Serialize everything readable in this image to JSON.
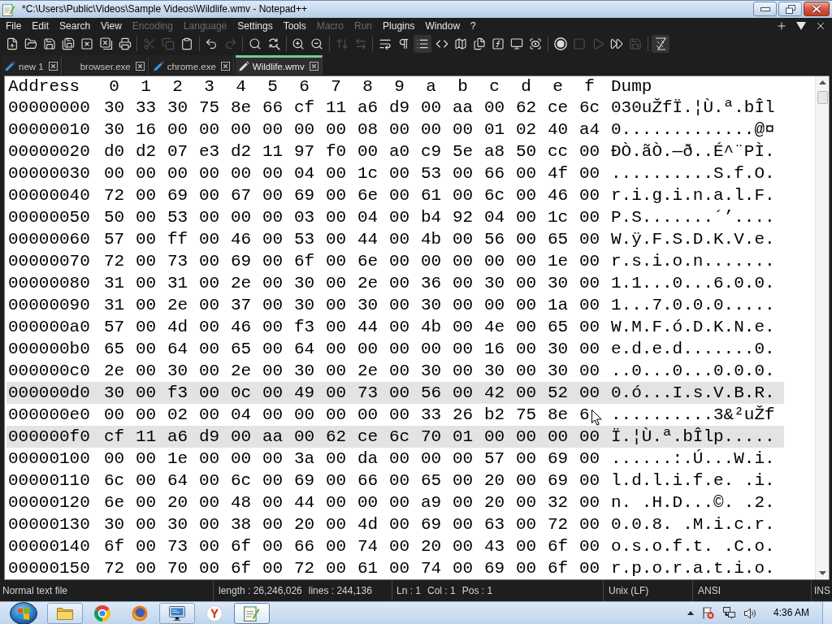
{
  "window": {
    "title": "*C:\\Users\\Public\\Videos\\Sample Videos\\Wildlife.wmv - Notepad++"
  },
  "menu": [
    {
      "label": "File",
      "disabled": false
    },
    {
      "label": "Edit",
      "disabled": false
    },
    {
      "label": "Search",
      "disabled": false
    },
    {
      "label": "View",
      "disabled": false
    },
    {
      "label": "Encoding",
      "disabled": true
    },
    {
      "label": "Language",
      "disabled": true
    },
    {
      "label": "Settings",
      "disabled": false
    },
    {
      "label": "Tools",
      "disabled": false
    },
    {
      "label": "Macro",
      "disabled": true
    },
    {
      "label": "Run",
      "disabled": true
    },
    {
      "label": "Plugins",
      "disabled": false
    },
    {
      "label": "Window",
      "disabled": false
    },
    {
      "label": "?",
      "disabled": false
    }
  ],
  "toolbar": [
    [
      {
        "disabled": false,
        "pressed": false
      },
      {
        "disabled": false,
        "pressed": false
      },
      {
        "disabled": false,
        "pressed": false
      },
      {
        "disabled": false,
        "pressed": false
      },
      {
        "disabled": false,
        "pressed": false
      },
      {
        "disabled": false,
        "pressed": false
      },
      {
        "disabled": false,
        "pressed": false
      }
    ],
    [
      {
        "disabled": true,
        "pressed": false
      },
      {
        "disabled": true,
        "pressed": false
      },
      {
        "disabled": false,
        "pressed": false
      }
    ],
    [
      {
        "disabled": false,
        "pressed": false
      },
      {
        "disabled": true,
        "pressed": false
      }
    ],
    [
      {
        "disabled": false,
        "pressed": false
      },
      {
        "disabled": false,
        "pressed": false
      }
    ],
    [
      {
        "disabled": false,
        "pressed": false
      },
      {
        "disabled": false,
        "pressed": false
      }
    ],
    [
      {
        "disabled": true,
        "pressed": false
      },
      {
        "disabled": true,
        "pressed": false
      }
    ],
    [
      {
        "disabled": false,
        "pressed": false
      },
      {
        "disabled": false,
        "pressed": false
      },
      {
        "disabled": false,
        "pressed": true
      },
      {
        "disabled": false,
        "pressed": false
      },
      {
        "disabled": false,
        "pressed": false
      },
      {
        "disabled": false,
        "pressed": false
      },
      {
        "disabled": false,
        "pressed": false
      },
      {
        "disabled": false,
        "pressed": false
      },
      {
        "disabled": false,
        "pressed": false
      }
    ],
    [
      {
        "disabled": false,
        "pressed": false
      },
      {
        "disabled": true,
        "pressed": false
      },
      {
        "disabled": true,
        "pressed": false
      },
      {
        "disabled": false,
        "pressed": false
      },
      {
        "disabled": true,
        "pressed": false
      }
    ],
    [
      {
        "disabled": false,
        "pressed": true
      }
    ]
  ],
  "tabs": [
    {
      "label": "new 1",
      "edited": true,
      "selected": false
    },
    {
      "label": "browser.exe",
      "edited": false,
      "selected": false
    },
    {
      "label": "chrome.exe",
      "edited": true,
      "selected": false
    },
    {
      "label": "Wildlife.wmv",
      "edited": true,
      "selected": true
    }
  ],
  "hex_view": {
    "columns": [
      "Address",
      "0",
      "1",
      "2",
      "3",
      "4",
      "5",
      "6",
      "7",
      "8",
      "9",
      "a",
      "b",
      "c",
      "d",
      "e",
      "f",
      "Dump"
    ],
    "rows": [
      {
        "address": "00000000",
        "bytes": [
          "30",
          "33",
          "30",
          "75",
          "8e",
          "66",
          "cf",
          "11",
          "a6",
          "d9",
          "00",
          "aa",
          "00",
          "62",
          "ce",
          "6c"
        ],
        "dump": "030uŽfÏ.¦Ù.ª.bÎl",
        "highlighted": false,
        "pointer": false
      },
      {
        "address": "00000010",
        "bytes": [
          "30",
          "16",
          "00",
          "00",
          "00",
          "00",
          "00",
          "00",
          "08",
          "00",
          "00",
          "00",
          "01",
          "02",
          "40",
          "a4"
        ],
        "dump": "0.............@¤",
        "highlighted": false,
        "pointer": false
      },
      {
        "address": "00000020",
        "bytes": [
          "d0",
          "d2",
          "07",
          "e3",
          "d2",
          "11",
          "97",
          "f0",
          "00",
          "a0",
          "c9",
          "5e",
          "a8",
          "50",
          "cc",
          "00"
        ],
        "dump": "ÐÒ.ãÒ.—ð..É^¨PÌ.",
        "highlighted": false,
        "pointer": false
      },
      {
        "address": "00000030",
        "bytes": [
          "00",
          "00",
          "00",
          "00",
          "00",
          "00",
          "04",
          "00",
          "1c",
          "00",
          "53",
          "00",
          "66",
          "00",
          "4f",
          "00"
        ],
        "dump": "..........S.f.O.",
        "highlighted": false,
        "pointer": false
      },
      {
        "address": "00000040",
        "bytes": [
          "72",
          "00",
          "69",
          "00",
          "67",
          "00",
          "69",
          "00",
          "6e",
          "00",
          "61",
          "00",
          "6c",
          "00",
          "46",
          "00"
        ],
        "dump": "r.i.g.i.n.a.l.F.",
        "highlighted": false,
        "pointer": false
      },
      {
        "address": "00000050",
        "bytes": [
          "50",
          "00",
          "53",
          "00",
          "00",
          "00",
          "03",
          "00",
          "04",
          "00",
          "b4",
          "92",
          "04",
          "00",
          "1c",
          "00"
        ],
        "dump": "P.S.......´’....",
        "highlighted": false,
        "pointer": false
      },
      {
        "address": "00000060",
        "bytes": [
          "57",
          "00",
          "ff",
          "00",
          "46",
          "00",
          "53",
          "00",
          "44",
          "00",
          "4b",
          "00",
          "56",
          "00",
          "65",
          "00"
        ],
        "dump": "W.ÿ.F.S.D.K.V.e.",
        "highlighted": false,
        "pointer": false
      },
      {
        "address": "00000070",
        "bytes": [
          "72",
          "00",
          "73",
          "00",
          "69",
          "00",
          "6f",
          "00",
          "6e",
          "00",
          "00",
          "00",
          "00",
          "00",
          "1e",
          "00"
        ],
        "dump": "r.s.i.o.n.......",
        "highlighted": false,
        "pointer": false
      },
      {
        "address": "00000080",
        "bytes": [
          "31",
          "00",
          "31",
          "00",
          "2e",
          "00",
          "30",
          "00",
          "2e",
          "00",
          "36",
          "00",
          "30",
          "00",
          "30",
          "00"
        ],
        "dump": "1.1...0...6.0.0.",
        "highlighted": false,
        "pointer": false
      },
      {
        "address": "00000090",
        "bytes": [
          "31",
          "00",
          "2e",
          "00",
          "37",
          "00",
          "30",
          "00",
          "30",
          "00",
          "30",
          "00",
          "00",
          "00",
          "1a",
          "00"
        ],
        "dump": "1...7.0.0.0.....",
        "highlighted": false,
        "pointer": false
      },
      {
        "address": "000000a0",
        "bytes": [
          "57",
          "00",
          "4d",
          "00",
          "46",
          "00",
          "f3",
          "00",
          "44",
          "00",
          "4b",
          "00",
          "4e",
          "00",
          "65",
          "00"
        ],
        "dump": "W.M.F.ó.D.K.N.e.",
        "highlighted": false,
        "pointer": false
      },
      {
        "address": "000000b0",
        "bytes": [
          "65",
          "00",
          "64",
          "00",
          "65",
          "00",
          "64",
          "00",
          "00",
          "00",
          "00",
          "00",
          "16",
          "00",
          "30",
          "00"
        ],
        "dump": "e.d.e.d.......0.",
        "highlighted": false,
        "pointer": false
      },
      {
        "address": "000000c0",
        "bytes": [
          "2e",
          "00",
          "30",
          "00",
          "2e",
          "00",
          "30",
          "00",
          "2e",
          "00",
          "30",
          "00",
          "30",
          "00",
          "30",
          "00"
        ],
        "dump": "..0...0...0.0.0.",
        "highlighted": false,
        "pointer": false
      },
      {
        "address": "000000d0",
        "bytes": [
          "30",
          "00",
          "f3",
          "00",
          "0c",
          "00",
          "49",
          "00",
          "73",
          "00",
          "56",
          "00",
          "42",
          "00",
          "52",
          "00"
        ],
        "dump": "0.ó...I.s.V.B.R.",
        "highlighted": true,
        "pointer": false
      },
      {
        "address": "000000e0",
        "bytes": [
          "00",
          "00",
          "02",
          "00",
          "04",
          "00",
          "00",
          "00",
          "00",
          "00",
          "33",
          "26",
          "b2",
          "75",
          "8e",
          "6"
        ],
        "dump": "..........3&²uŽf",
        "highlighted": false,
        "pointer": true
      },
      {
        "address": "000000f0",
        "bytes": [
          "cf",
          "11",
          "a6",
          "d9",
          "00",
          "aa",
          "00",
          "62",
          "ce",
          "6c",
          "70",
          "01",
          "00",
          "00",
          "00",
          "00"
        ],
        "dump": "Ï.¦Ù.ª.bÎlp.....",
        "highlighted": true,
        "pointer": false
      },
      {
        "address": "00000100",
        "bytes": [
          "00",
          "00",
          "1e",
          "00",
          "00",
          "00",
          "3a",
          "00",
          "da",
          "00",
          "00",
          "00",
          "57",
          "00",
          "69",
          "00"
        ],
        "dump": "......:.Ú...W.i.",
        "highlighted": false,
        "pointer": false
      },
      {
        "address": "00000110",
        "bytes": [
          "6c",
          "00",
          "64",
          "00",
          "6c",
          "00",
          "69",
          "00",
          "66",
          "00",
          "65",
          "00",
          "20",
          "00",
          "69",
          "00"
        ],
        "dump": "l.d.l.i.f.e. .i.",
        "highlighted": false,
        "pointer": false
      },
      {
        "address": "00000120",
        "bytes": [
          "6e",
          "00",
          "20",
          "00",
          "48",
          "00",
          "44",
          "00",
          "00",
          "00",
          "a9",
          "00",
          "20",
          "00",
          "32",
          "00"
        ],
        "dump": "n. .H.D...©. .2.",
        "highlighted": false,
        "pointer": false
      },
      {
        "address": "00000130",
        "bytes": [
          "30",
          "00",
          "30",
          "00",
          "38",
          "00",
          "20",
          "00",
          "4d",
          "00",
          "69",
          "00",
          "63",
          "00",
          "72",
          "00"
        ],
        "dump": "0.0.8. .M.i.c.r.",
        "highlighted": false,
        "pointer": false
      },
      {
        "address": "00000140",
        "bytes": [
          "6f",
          "00",
          "73",
          "00",
          "6f",
          "00",
          "66",
          "00",
          "74",
          "00",
          "20",
          "00",
          "43",
          "00",
          "6f",
          "00"
        ],
        "dump": "o.s.o.f.t. .C.o.",
        "highlighted": false,
        "pointer": false
      },
      {
        "address": "00000150",
        "bytes": [
          "72",
          "00",
          "70",
          "00",
          "6f",
          "00",
          "72",
          "00",
          "61",
          "00",
          "74",
          "00",
          "69",
          "00",
          "6f",
          "00"
        ],
        "dump": "r.p.o.r.a.t.i.o.",
        "highlighted": false,
        "pointer": false
      }
    ]
  },
  "status_bar": {
    "file_type": "Normal text file",
    "length": "length : 26,246,026",
    "lines": "lines : 244,136",
    "line": "Ln : 1",
    "column": "Col : 1",
    "position": "Pos : 1",
    "line_ending": "Unix (LF)",
    "encoding": "ANSI",
    "insert_mode": "INS"
  },
  "taskbar": {
    "apps": [
      {
        "running": true,
        "active": false
      },
      {
        "running": false,
        "active": false
      },
      {
        "running": false,
        "active": false
      },
      {
        "running": true,
        "active": false
      },
      {
        "running": false,
        "active": false
      },
      {
        "running": true,
        "active": true
      }
    ],
    "clock": "4:36 AM"
  }
}
